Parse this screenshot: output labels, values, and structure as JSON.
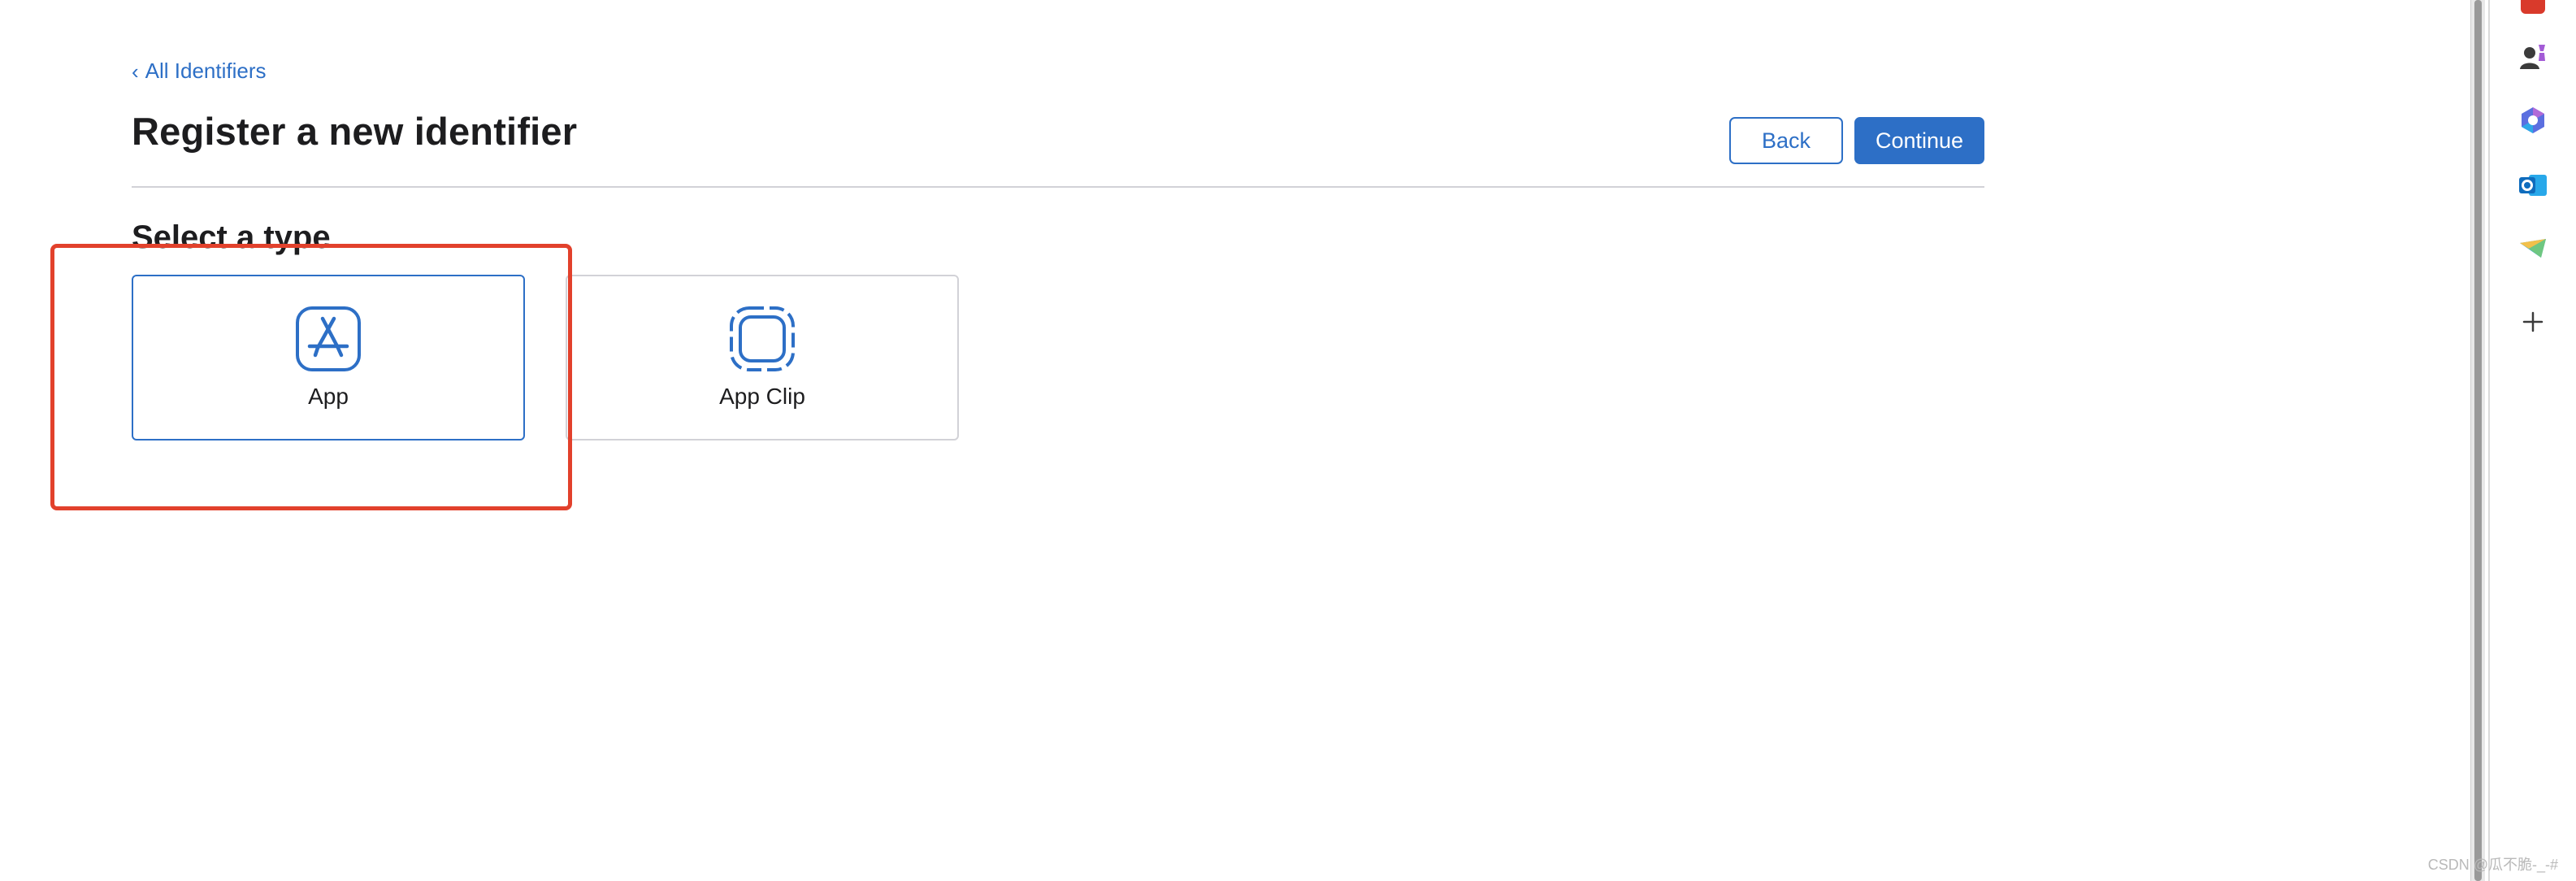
{
  "breadcrumb": {
    "label": "All Identifiers",
    "chevron": "‹"
  },
  "header": {
    "title": "Register a new identifier",
    "back_label": "Back",
    "continue_label": "Continue"
  },
  "section": {
    "title": "Select a type"
  },
  "types": [
    {
      "label": "App",
      "icon": "app-store-icon",
      "selected": true
    },
    {
      "label": "App Clip",
      "icon": "app-clip-icon",
      "selected": false
    }
  ],
  "sidebar": {
    "icons": [
      "red-app-icon",
      "users-icon",
      "copilot-icon",
      "outlook-icon",
      "telegram-icon",
      "plus-icon"
    ]
  },
  "colors": {
    "accent": "#2d6fc6",
    "highlight": "#e2412c",
    "divider": "#d2d2d7"
  },
  "watermark": "CSDN @瓜不脆-_-#"
}
